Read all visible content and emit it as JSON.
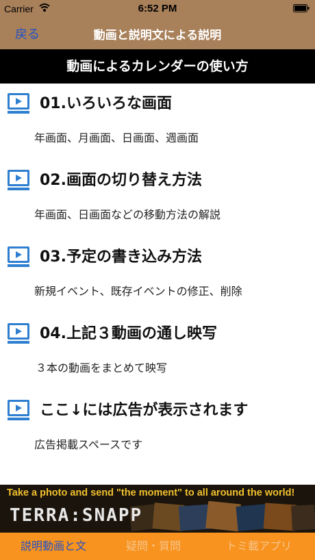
{
  "status_bar": {
    "carrier": "Carrier",
    "time": "6:52 PM"
  },
  "nav": {
    "back_label": "戻る",
    "title": "動画と説明文による説明"
  },
  "section_header": "動画によるカレンダーの使い方",
  "items": [
    {
      "title": "01.いろいろな画面",
      "description": "年画面、月画面、日画面、週画面"
    },
    {
      "title": "02.画面の切り替え方法",
      "description": "年画面、日画面などの移動方法の解説"
    },
    {
      "title": "03.予定の書き込み方法",
      "description": "新規イベント、既存イベントの修正、削除"
    },
    {
      "title": "04.上記３動画の通し映写",
      "description": "３本の動画をまとめて映写"
    },
    {
      "title": "ここ↓には広告が表示されます",
      "description": "広告掲載スペースです"
    }
  ],
  "ad": {
    "headline": "Take a photo and send  \"the moment\" to all around the world!",
    "brand": "TERRA:SNAPP"
  },
  "tabs": [
    {
      "label": "説明動画と文",
      "state": "active"
    },
    {
      "label": "疑問・質問",
      "state": "inactive"
    },
    {
      "label": "トミ載アプリ",
      "state": "inactive"
    }
  ],
  "colors": {
    "bar": "#a8805a",
    "header": "#000000",
    "icon": "#2f7fd0",
    "tab_bar": "#f7931e",
    "tab_active": "#2050c8"
  }
}
